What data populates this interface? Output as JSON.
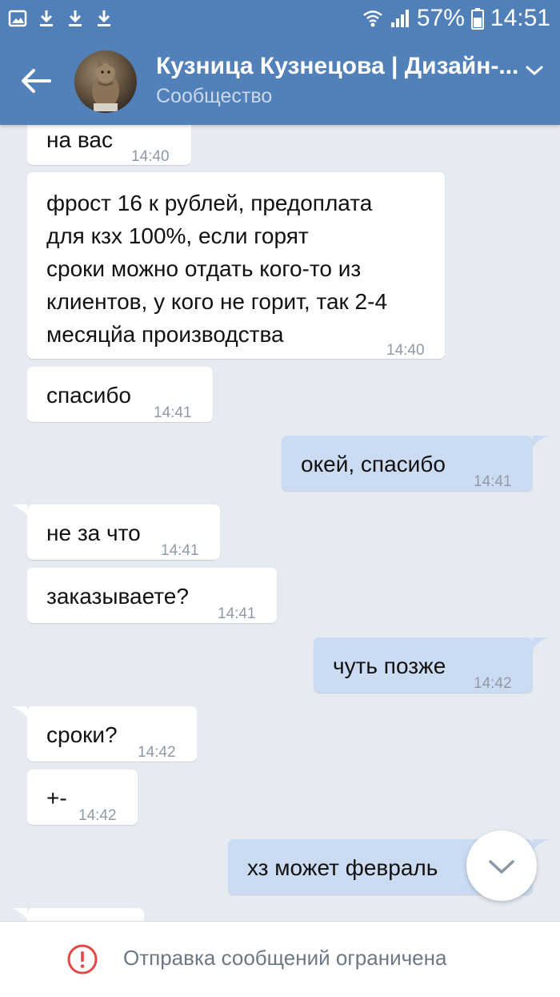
{
  "status_bar": {
    "battery": "57%",
    "time": "14:51"
  },
  "header": {
    "title": "Кузница Кузнецова | Дизайн-...",
    "subtitle": "Сообщество"
  },
  "messages": [
    {
      "direction": "in",
      "text": "на вас",
      "time": "14:40"
    },
    {
      "direction": "in",
      "text": "фрост 16 к рублей, предоплата для кзх 100%, если горят сроки можно отдать кого-то из клиентов, у кого не горит, так 2-4 месяцйа производства",
      "time": "14:40"
    },
    {
      "direction": "in",
      "text": "спасибо",
      "time": "14:41"
    },
    {
      "direction": "out",
      "text": "окей, спасибо",
      "time": "14:41"
    },
    {
      "direction": "in",
      "text": "не за что",
      "time": "14:41"
    },
    {
      "direction": "in",
      "text": "заказываете?",
      "time": "14:41"
    },
    {
      "direction": "out",
      "text": "чуть позже",
      "time": "14:42"
    },
    {
      "direction": "in",
      "text": "сроки?",
      "time": "14:42"
    },
    {
      "direction": "in",
      "text": "+-",
      "time": "14:42"
    },
    {
      "direction": "out",
      "text": "хз может февраль",
      "time": ""
    }
  ],
  "multiline_lines": [
    "фрост 16 к рублей, предоплата",
    "для кзх 100%, если горят",
    "сроки можно отдать кого-то из",
    "клиентов, у кого не горит, так 2-4",
    "месяцйа производства"
  ],
  "bottom_bar": {
    "notice": "Отправка сообщений ограничена"
  },
  "colors": {
    "header_bg": "#5181b8",
    "chat_bg": "#e6ebf2",
    "incoming_bubble": "#ffffff",
    "outgoing_bubble": "#cbdcf2",
    "warning_red": "#e64646"
  }
}
